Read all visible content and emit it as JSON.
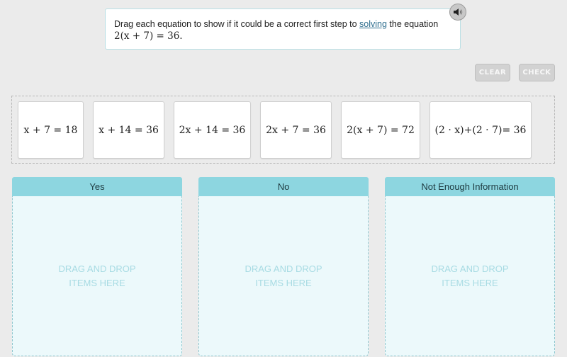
{
  "prompt": {
    "text_before": "Drag each equation to show if it could be a correct first step to ",
    "link_text": "solving",
    "text_after": " the equation",
    "equation": "2(x + 7) = 36."
  },
  "audio": {
    "icon": "speaker-icon",
    "label": "Read aloud"
  },
  "toolbar": {
    "clear_label": "CLEAR",
    "check_label": "CHECK"
  },
  "tiles": [
    {
      "label": "x + 7 = 18"
    },
    {
      "label": "x + 14 = 36"
    },
    {
      "label": "2x + 14 = 36"
    },
    {
      "label": "2x + 7 = 36"
    },
    {
      "label": "2(x + 7) = 72"
    },
    {
      "label": "(2 · x)+(2 · 7)= 36"
    }
  ],
  "bins": [
    {
      "title": "Yes",
      "hint": "DRAG AND DROP ITEMS HERE"
    },
    {
      "title": "No",
      "hint": "DRAG AND DROP ITEMS HERE"
    },
    {
      "title": "Not Enough Information",
      "hint": "DRAG AND DROP ITEMS HERE"
    }
  ],
  "colors": {
    "bin_header": "#8dd6e0",
    "bin_body": "#ecf9fb",
    "link": "#2f6f8f"
  }
}
